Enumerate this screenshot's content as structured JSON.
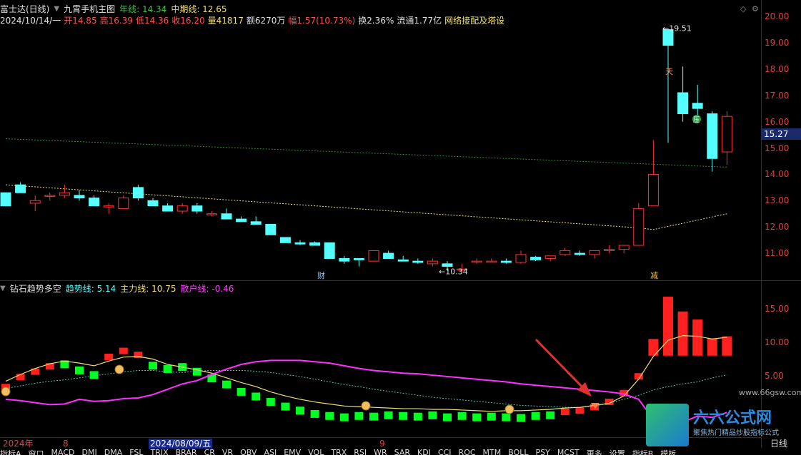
{
  "header": {
    "stock": "富士达(日线)",
    "indicator_name": "九霄手机主图",
    "year_line_label": "年线: 14.34",
    "mid_line_label": "中期线: 12.65",
    "date_row": "2024/10/14/一",
    "open": "开14.85",
    "high": "高16.39",
    "low": "低14.36",
    "close": "收16.20",
    "volume": "量41817",
    "amount": "额6270万",
    "change": "幅1.57(10.73%)",
    "turnover": "换2.36%",
    "float_cap": "流通1.77亿",
    "concept": "网络接配及塔设"
  },
  "main_chart": {
    "y_ticks": [
      "20.00",
      "19.00",
      "18.00",
      "17.00",
      "16.00",
      "15.00",
      "14.00",
      "13.00",
      "12.00",
      "11.00"
    ],
    "current_price_tag": "15.27",
    "high_marker": "19.51",
    "low_marker": "10.34",
    "event_labels": [
      "财",
      "减"
    ],
    "annotation_marks": [
      "天",
      "压"
    ]
  },
  "indicator": {
    "name": "钻石趋势多空",
    "trend_label": "趋势线: 5.14",
    "main_force_label": "主力线: 10.75",
    "retail_label": "散户线: -0.46",
    "y_ticks": [
      "15.00",
      "10.00",
      "5.00"
    ]
  },
  "x_axis": {
    "labels": [
      "2024年",
      "8",
      "2024/08/09/五",
      "9"
    ],
    "period": "日线"
  },
  "tabs": [
    "指标A",
    "窗口",
    "MACD",
    "DMI",
    "DMA",
    "FSL",
    "TRIX",
    "BRAR",
    "CR",
    "VR",
    "OBV",
    "ASI",
    "EMV",
    "VOL",
    "TRX",
    "RSI",
    "WR",
    "SAR",
    "KDJ",
    "CCI",
    "ROC",
    "MTM",
    "BOLL",
    "PSY",
    "MCST",
    "更多",
    "设置",
    "指标B",
    "模板"
  ],
  "watermark": {
    "site": "www.66gsw.com",
    "brand": "六六公式网",
    "slogan": "聚焦热门精品炒股指标公式"
  },
  "colors": {
    "up": "#ff3232",
    "down": "#54ffff",
    "year_line": "#2f8f2f",
    "mid_line": "#e8e070",
    "retail_line": "#ff30ff",
    "axis": "#a00000"
  }
}
